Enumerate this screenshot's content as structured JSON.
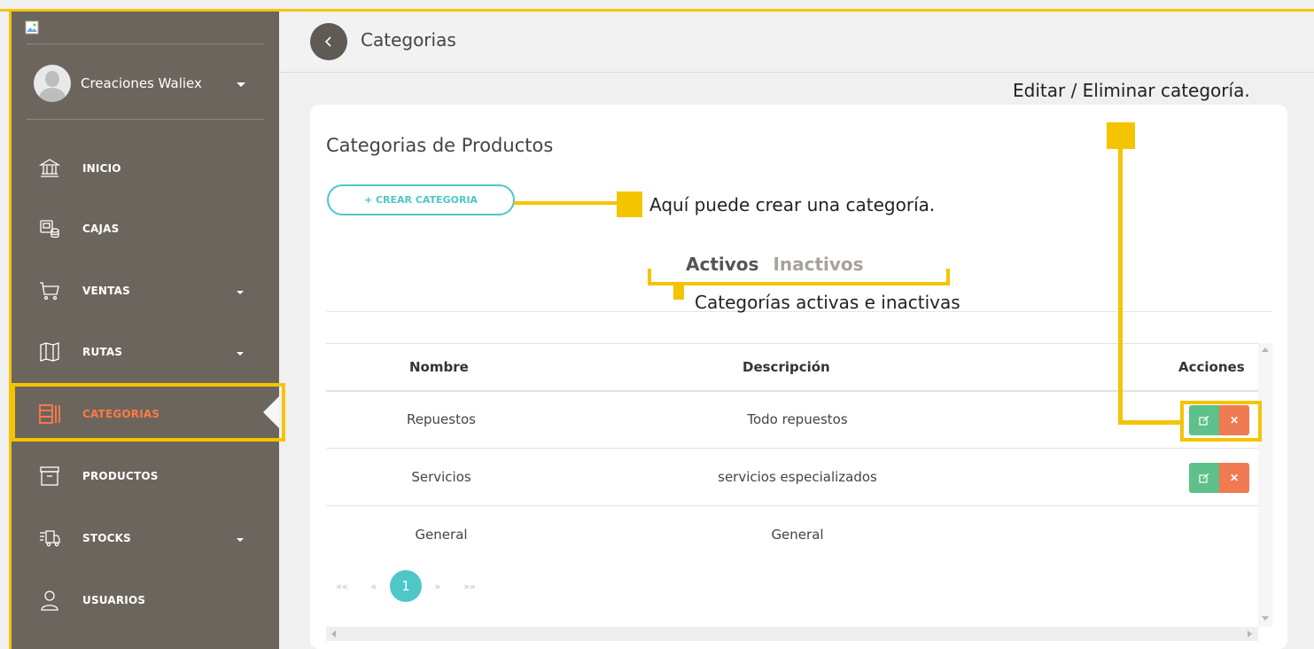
{
  "sidebar": {
    "user_name": "Creaciones Waliex",
    "items": [
      {
        "label": "INICIO",
        "icon": "bank-icon"
      },
      {
        "label": "CAJAS",
        "icon": "cash-register-icon"
      },
      {
        "label": "VENTAS",
        "icon": "cart-icon"
      },
      {
        "label": "RUTAS",
        "icon": "map-icon"
      },
      {
        "label": "CATEGORIAS",
        "icon": "categories-icon",
        "active": true
      },
      {
        "label": "PRODUCTOS",
        "icon": "archive-box-icon"
      },
      {
        "label": "STOCKS",
        "icon": "truck-icon"
      },
      {
        "label": "USUARIOS",
        "icon": "user-icon"
      }
    ],
    "colors": {
      "background": "#6c655d",
      "active": "#ff7a45"
    }
  },
  "topbar": {
    "title": "Categorias"
  },
  "card": {
    "title": "Categorias de Productos",
    "create_button": "+ CREAR CATEGORIA",
    "tabs": [
      {
        "label": "Activos",
        "selected": true
      },
      {
        "label": "Inactivos",
        "selected": false
      }
    ]
  },
  "table": {
    "headers": [
      "Nombre",
      "Descripción",
      "Acciones"
    ],
    "rows": [
      {
        "nombre": "Repuestos",
        "descripcion": "Todo repuestos",
        "actions": true
      },
      {
        "nombre": "Servicios",
        "descripcion": "servicios especializados",
        "actions": true
      },
      {
        "nombre": "General",
        "descripcion": "General",
        "actions": false
      }
    ]
  },
  "pagination": {
    "first": "««",
    "prev": "«",
    "current": "1",
    "next": "»",
    "last": "»»"
  },
  "annotations": {
    "actions": "Editar / Eliminar categoría.",
    "create": "Aquí puede crear una categoría.",
    "tabs": "Categorías activas e inactivas"
  },
  "colors": {
    "highlight": "#f5c400",
    "accent": "#4fc6c8",
    "edit": "#5ec08a",
    "delete": "#f07a52"
  }
}
